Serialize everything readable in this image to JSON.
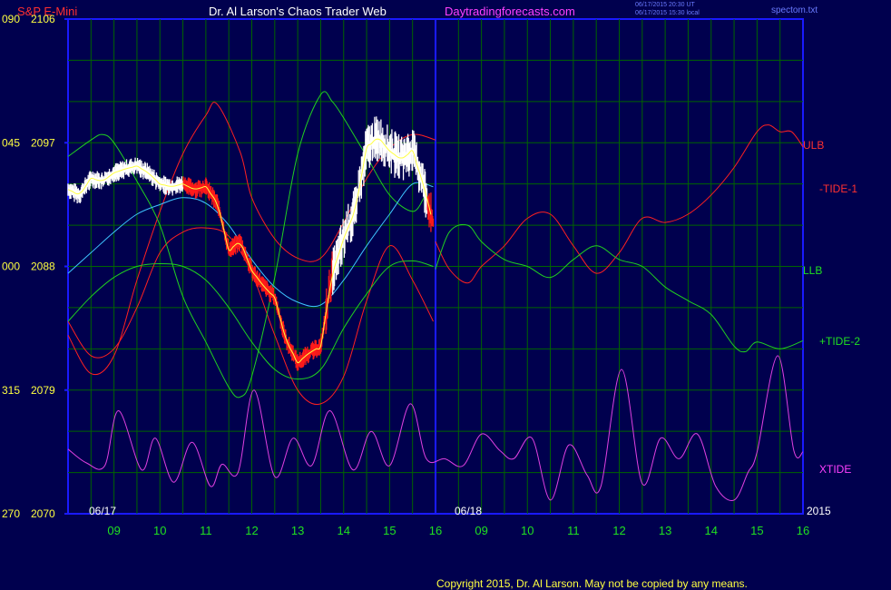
{
  "header": {
    "instrument": "S&P E-Mini",
    "title": "Dr. Al Larson's Chaos Trader Web",
    "site": "Daytradingforecasts.com",
    "stamp_1": "06/17/2015 20:30 UT",
    "stamp_2": "06/17/2015 15:30 local",
    "file": "spectom.txt"
  },
  "footer": {
    "copyright": "Copyright 2015, Dr. Al Larson. May not be copied by any means."
  },
  "colors": {
    "background": "#00004e",
    "frame": "#1a1aff",
    "grid": "#006400",
    "price_white": "#ffffff",
    "price_red": "#ff1a1a",
    "yellow": "#ffff40",
    "cyan": "#3ec4ff",
    "ulb": "#ff2020",
    "llb": "#20d020",
    "xtide": "#e040e0",
    "green_text": "#20e020",
    "red_text": "#ff3030",
    "magenta_text": "#ff40ff",
    "tiny_text": "#6a7aff"
  },
  "chart_data": {
    "type": "line",
    "y_ticks": [
      {
        "left": "090",
        "right": "2106"
      },
      {
        "left": "045",
        "right": "2097"
      },
      {
        "left": "000",
        "right": "2088"
      },
      {
        "left": "315",
        "right": "2079"
      },
      {
        "left": "270",
        "right": "2070"
      }
    ],
    "ylim": [
      2070,
      2106
    ],
    "x_ticks": [
      "09",
      "10",
      "11",
      "12",
      "13",
      "14",
      "15",
      "16",
      "09",
      "10",
      "11",
      "12",
      "13",
      "14",
      "15",
      "16"
    ],
    "date_labels": [
      "06/17",
      "06/18"
    ],
    "year_label": "2015",
    "series_labels": [
      {
        "name": "ULB",
        "color": "#ff3030"
      },
      {
        "name": "-TIDE-1",
        "color": "#ff3030"
      },
      {
        "name": "LLB",
        "color": "#20e020"
      },
      {
        "name": "+TIDE-2",
        "color": "#20e020"
      },
      {
        "name": "XTIDE",
        "color": "#ff40ff"
      }
    ],
    "price_path": [
      [
        8.0,
        2093.6
      ],
      [
        8.25,
        2093.2
      ],
      [
        8.5,
        2094.4
      ],
      [
        8.75,
        2094.2
      ],
      [
        9.0,
        2094.8
      ],
      [
        9.25,
        2095.1
      ],
      [
        9.5,
        2095.3
      ],
      [
        9.75,
        2094.8
      ],
      [
        10.0,
        2094.0
      ],
      [
        10.25,
        2093.8
      ],
      [
        10.5,
        2094.0
      ],
      [
        10.75,
        2093.6
      ],
      [
        11.0,
        2093.8
      ],
      [
        11.25,
        2092.6
      ],
      [
        11.5,
        2089.2
      ],
      [
        11.75,
        2089.8
      ],
      [
        12.0,
        2087.7
      ],
      [
        12.25,
        2086.6
      ],
      [
        12.5,
        2085.7
      ],
      [
        12.75,
        2082.6
      ],
      [
        13.0,
        2081.0
      ],
      [
        13.25,
        2081.7
      ],
      [
        13.5,
        2082.2
      ],
      [
        13.75,
        2087.4
      ],
      [
        14.0,
        2090.0
      ],
      [
        14.25,
        2092.1
      ],
      [
        14.5,
        2096.6
      ],
      [
        14.75,
        2097.4
      ],
      [
        15.0,
        2096.4
      ],
      [
        15.25,
        2095.8
      ],
      [
        15.5,
        2096.4
      ],
      [
        15.75,
        2093.8
      ],
      [
        15.95,
        2091.1
      ]
    ],
    "red_price_from": 10.5,
    "ulb_p1": [
      [
        8.0,
        2083.0
      ],
      [
        8.5,
        2080.2
      ],
      [
        9.0,
        2081.5
      ],
      [
        9.5,
        2087.0
      ],
      [
        10.0,
        2092.0
      ],
      [
        10.5,
        2096.2
      ],
      [
        11.0,
        2099.0
      ],
      [
        11.25,
        2099.8
      ],
      [
        11.75,
        2096.3
      ],
      [
        12.0,
        2093.0
      ],
      [
        12.5,
        2090.0
      ],
      [
        13.0,
        2088.6
      ],
      [
        13.5,
        2088.6
      ],
      [
        14.0,
        2091.2
      ],
      [
        14.5,
        2094.4
      ],
      [
        15.0,
        2096.6
      ],
      [
        15.5,
        2097.6
      ],
      [
        16.0,
        2097.2
      ]
    ],
    "llb_p1": [
      [
        8.0,
        2096.0
      ],
      [
        8.5,
        2097.2
      ],
      [
        8.75,
        2097.6
      ],
      [
        9.0,
        2097.0
      ],
      [
        9.5,
        2094.2
      ],
      [
        10.0,
        2091.0
      ],
      [
        10.5,
        2085.8
      ],
      [
        11.0,
        2082.5
      ],
      [
        11.5,
        2079.2
      ],
      [
        11.75,
        2078.5
      ],
      [
        12.0,
        2080.0
      ],
      [
        12.5,
        2087.2
      ],
      [
        13.0,
        2096.2
      ],
      [
        13.5,
        2100.5
      ],
      [
        13.75,
        2100.0
      ],
      [
        14.0,
        2098.8
      ],
      [
        14.5,
        2096.0
      ],
      [
        15.0,
        2093.2
      ],
      [
        15.5,
        2092.0
      ],
      [
        15.75,
        2093.0
      ]
    ],
    "red_low_p1": [
      [
        8.0,
        2084.0
      ],
      [
        8.5,
        2081.5
      ],
      [
        9.0,
        2082.0
      ],
      [
        9.5,
        2085.0
      ],
      [
        10.0,
        2089.0
      ],
      [
        10.5,
        2090.5
      ],
      [
        11.0,
        2090.8
      ],
      [
        11.5,
        2090.2
      ],
      [
        12.0,
        2087.5
      ],
      [
        12.5,
        2083.0
      ],
      [
        13.0,
        2079.0
      ],
      [
        13.5,
        2078.0
      ],
      [
        14.0,
        2080.0
      ],
      [
        14.5,
        2085.5
      ],
      [
        15.0,
        2089.5
      ],
      [
        15.5,
        2087.0
      ],
      [
        15.95,
        2084.0
      ]
    ],
    "green_low_p1": [
      [
        8.0,
        2084.0
      ],
      [
        8.5,
        2085.8
      ],
      [
        9.0,
        2087.2
      ],
      [
        9.5,
        2088.0
      ],
      [
        10.0,
        2088.2
      ],
      [
        10.5,
        2088.0
      ],
      [
        11.0,
        2087.0
      ],
      [
        11.5,
        2085.0
      ],
      [
        12.0,
        2082.5
      ],
      [
        12.5,
        2080.5
      ],
      [
        13.0,
        2079.8
      ],
      [
        13.5,
        2080.5
      ],
      [
        14.0,
        2083.5
      ],
      [
        14.5,
        2086.0
      ],
      [
        15.0,
        2088.0
      ],
      [
        15.5,
        2088.4
      ],
      [
        15.95,
        2088.0
      ]
    ],
    "cyan_ma": [
      [
        8.0,
        2087.5
      ],
      [
        8.5,
        2089.0
      ],
      [
        9.0,
        2090.5
      ],
      [
        9.5,
        2091.8
      ],
      [
        10.0,
        2092.5
      ],
      [
        10.5,
        2093.0
      ],
      [
        11.0,
        2092.6
      ],
      [
        11.5,
        2091.0
      ],
      [
        12.0,
        2088.5
      ],
      [
        12.5,
        2086.5
      ],
      [
        13.0,
        2085.4
      ],
      [
        13.5,
        2085.2
      ],
      [
        14.0,
        2087.0
      ],
      [
        14.5,
        2089.5
      ],
      [
        15.0,
        2091.8
      ],
      [
        15.5,
        2094.0
      ],
      [
        15.95,
        2093.8
      ]
    ],
    "tide1": [
      [
        16.0,
        2089.8
      ],
      [
        16.3,
        2087.8
      ],
      [
        16.7,
        2086.8
      ],
      [
        17.0,
        2088.0
      ],
      [
        17.5,
        2089.5
      ],
      [
        18.0,
        2091.5
      ],
      [
        18.5,
        2091.8
      ],
      [
        19.0,
        2089.5
      ],
      [
        19.5,
        2087.5
      ],
      [
        20.0,
        2089.0
      ],
      [
        20.5,
        2091.5
      ],
      [
        21.0,
        2091.2
      ],
      [
        21.5,
        2091.8
      ],
      [
        22.0,
        2093.2
      ],
      [
        22.5,
        2095.2
      ],
      [
        23.0,
        2097.8
      ],
      [
        23.25,
        2098.3
      ],
      [
        23.5,
        2097.8
      ],
      [
        23.75,
        2097.8
      ],
      [
        24.0,
        2096.7
      ]
    ],
    "tide2": [
      [
        16.0,
        2087.8
      ],
      [
        16.3,
        2090.5
      ],
      [
        16.7,
        2091.0
      ],
      [
        17.0,
        2089.8
      ],
      [
        17.5,
        2088.5
      ],
      [
        18.0,
        2088.0
      ],
      [
        18.5,
        2087.2
      ],
      [
        19.0,
        2088.5
      ],
      [
        19.5,
        2089.5
      ],
      [
        20.0,
        2088.5
      ],
      [
        20.5,
        2088.0
      ],
      [
        21.0,
        2086.5
      ],
      [
        21.5,
        2085.5
      ],
      [
        22.0,
        2084.5
      ],
      [
        22.5,
        2082.2
      ],
      [
        22.75,
        2081.8
      ],
      [
        23.0,
        2082.5
      ],
      [
        23.5,
        2082.0
      ],
      [
        24.0,
        2082.6
      ]
    ],
    "xtide_path": [
      [
        8.0,
        2074.7
      ],
      [
        8.4,
        2073.7
      ],
      [
        8.8,
        2073.5
      ],
      [
        9.1,
        2077.5
      ],
      [
        9.6,
        2073.2
      ],
      [
        9.9,
        2075.5
      ],
      [
        10.3,
        2072.3
      ],
      [
        10.7,
        2075.2
      ],
      [
        11.1,
        2072.0
      ],
      [
        11.35,
        2073.6
      ],
      [
        11.7,
        2073.0
      ],
      [
        12.05,
        2079.0
      ],
      [
        12.5,
        2072.7
      ],
      [
        12.9,
        2075.5
      ],
      [
        13.3,
        2073.5
      ],
      [
        13.7,
        2077.5
      ],
      [
        14.2,
        2073.2
      ],
      [
        14.6,
        2076.0
      ],
      [
        15.0,
        2073.5
      ],
      [
        15.45,
        2078.0
      ],
      [
        15.8,
        2074.0
      ],
      [
        16.2,
        2074.0
      ],
      [
        16.6,
        2073.5
      ],
      [
        17.0,
        2075.8
      ],
      [
        17.4,
        2074.6
      ],
      [
        17.7,
        2074.0
      ],
      [
        18.1,
        2075.5
      ],
      [
        18.5,
        2071.0
      ],
      [
        18.9,
        2075.0
      ],
      [
        19.3,
        2072.8
      ],
      [
        19.6,
        2072.0
      ],
      [
        20.05,
        2080.5
      ],
      [
        20.5,
        2072.2
      ],
      [
        20.9,
        2075.5
      ],
      [
        21.3,
        2074.0
      ],
      [
        21.7,
        2075.8
      ],
      [
        22.1,
        2072.0
      ],
      [
        22.5,
        2071.0
      ],
      [
        22.8,
        2073.0
      ],
      [
        23.0,
        2074.5
      ],
      [
        23.45,
        2081.5
      ],
      [
        23.8,
        2074.6
      ],
      [
        24.0,
        2074.5
      ]
    ]
  }
}
